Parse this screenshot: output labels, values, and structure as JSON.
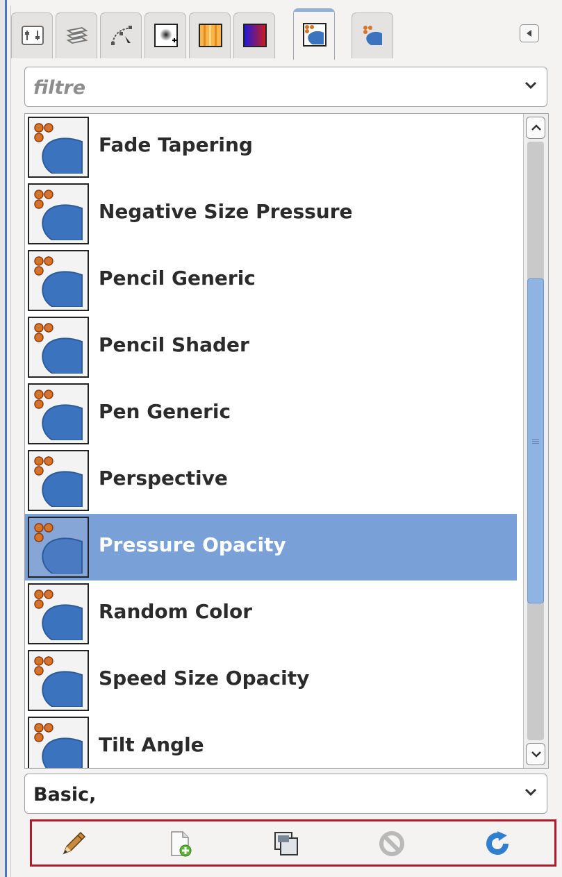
{
  "tabs": [
    {
      "icon": "tool-options-icon",
      "active": false
    },
    {
      "icon": "layers-icon",
      "active": false
    },
    {
      "icon": "paths-icon",
      "active": false
    },
    {
      "icon": "brushes-icon",
      "active": false
    },
    {
      "icon": "patterns-icon",
      "active": false
    },
    {
      "icon": "gradients-icon",
      "active": false
    },
    {
      "icon": "paint-dynamics-icon",
      "active": true
    },
    {
      "icon": "tool-presets-icon",
      "active": false
    }
  ],
  "collapse_icon": "triangle-left-icon",
  "filter": {
    "placeholder": "filtre",
    "value": ""
  },
  "items": [
    {
      "label": "Fade Tapering",
      "selected": false
    },
    {
      "label": "Negative Size Pressure",
      "selected": false
    },
    {
      "label": "Pencil Generic",
      "selected": false
    },
    {
      "label": "Pencil Shader",
      "selected": false
    },
    {
      "label": "Pen Generic",
      "selected": false
    },
    {
      "label": "Perspective",
      "selected": false
    },
    {
      "label": "Pressure Opacity",
      "selected": true
    },
    {
      "label": "Random Color",
      "selected": false
    },
    {
      "label": "Speed Size Opacity",
      "selected": false
    },
    {
      "label": "Tilt Angle",
      "selected": false
    }
  ],
  "scroll_position": 0.37,
  "tag_filter": {
    "value": "Basic,"
  },
  "toolbar": [
    {
      "icon": "edit-pencil-icon",
      "enabled": true
    },
    {
      "icon": "new-document-icon",
      "enabled": true
    },
    {
      "icon": "duplicate-icon",
      "enabled": true
    },
    {
      "icon": "delete-disabled-icon",
      "enabled": false
    },
    {
      "icon": "refresh-icon",
      "enabled": true
    }
  ],
  "colors": {
    "selection": "#79a1d8",
    "accent_blue": "#3b73bf",
    "dot_orange": "#d8742a",
    "toolbar_border": "#b01a2a"
  }
}
